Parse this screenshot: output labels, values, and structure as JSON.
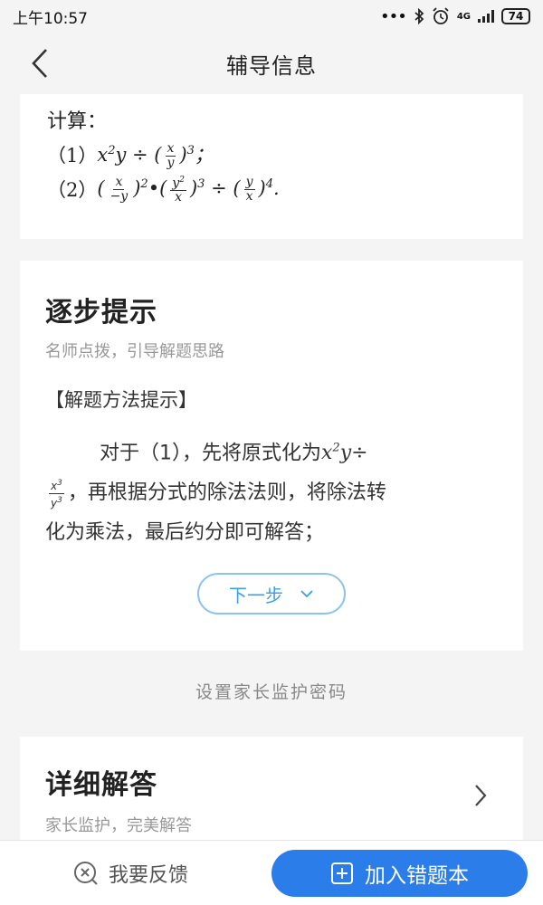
{
  "status": {
    "time": "上午10:57",
    "dots": "•••",
    "network": "4G",
    "battery": "74"
  },
  "nav": {
    "title": "辅导信息"
  },
  "question": {
    "intro": "计算：",
    "item1_label": "（1）",
    "item2_label": "（2）"
  },
  "hint": {
    "title": "逐步提示",
    "subtitle": "名师点拨，引导解题思路",
    "method": "【解题方法提示】",
    "text_part1": "对于（1），先将原式化为",
    "text_part2": "，再根据分式的除法法则，将除法转",
    "text_part3": "化为乘法，最后约分即可解答；",
    "next_label": "下一步"
  },
  "parent_link": "设置家长监护密码",
  "detail": {
    "title": "详细解答",
    "subtitle": "家长监护，完美解答"
  },
  "bottom": {
    "feedback_label": "我要反馈",
    "add_label": "加入错题本"
  },
  "colors": {
    "accent": "#2b7de9",
    "next_border": "#8cc3ee",
    "next_text": "#3aa0e6",
    "background": "#f4f4f4"
  }
}
